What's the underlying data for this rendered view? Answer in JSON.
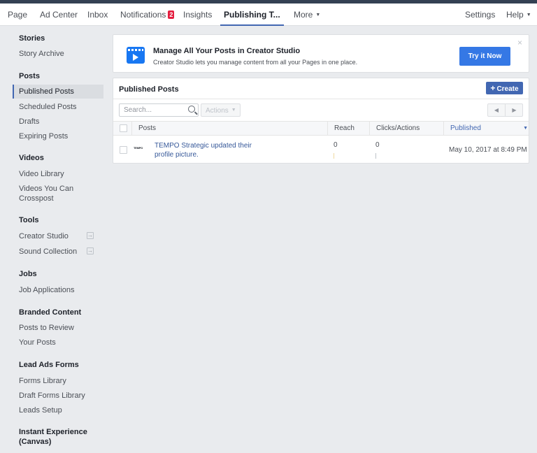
{
  "nav": {
    "items": [
      {
        "label": "Page"
      },
      {
        "label": "Ad Center"
      },
      {
        "label": "Inbox"
      },
      {
        "label": "Notifications",
        "badge": "2"
      },
      {
        "label": "Insights"
      },
      {
        "label": "Publishing T..."
      },
      {
        "label": "More"
      }
    ],
    "active": "Publishing T...",
    "settings_label": "Settings",
    "help_label": "Help"
  },
  "sidebar": {
    "sections": [
      {
        "heading": "Stories",
        "items": [
          "Story Archive"
        ]
      },
      {
        "heading": "Posts",
        "items": [
          "Published Posts",
          "Scheduled Posts",
          "Drafts",
          "Expiring Posts"
        ]
      },
      {
        "heading": "Videos",
        "items": [
          "Video Library",
          "Videos You Can Crosspost"
        ]
      },
      {
        "heading": "Tools",
        "items": [
          "Creator Studio",
          "Sound Collection"
        ]
      },
      {
        "heading": "Jobs",
        "items": [
          "Job Applications"
        ]
      },
      {
        "heading": "Branded Content",
        "items": [
          "Posts to Review",
          "Your Posts"
        ]
      },
      {
        "heading": "Lead Ads Forms",
        "items": [
          "Forms Library",
          "Draft Forms Library",
          "Leads Setup"
        ]
      },
      {
        "heading": "Instant Experience (Canvas)",
        "items": []
      }
    ],
    "active_item": "Published Posts"
  },
  "banner": {
    "icon": "creator-studio-clapper-icon",
    "title": "Manage All Your Posts in Creator Studio",
    "subtitle": "Creator Studio lets you manage content from all your Pages in one place.",
    "button_label": "Try it Now",
    "close_glyph": "×"
  },
  "panel": {
    "title": "Published Posts",
    "create_label": "Create",
    "search_placeholder": "Search...",
    "actions_label": "Actions",
    "columns": [
      "Posts",
      "Reach",
      "Clicks/Actions",
      "Published"
    ],
    "sorted_column": "Published",
    "rows": [
      {
        "thumb_text": "TEMPO",
        "post": "TEMPO Strategic updated their profile picture.",
        "reach": "0",
        "clicks": "0",
        "published": "May 10, 2017 at 8:49 PM"
      }
    ]
  },
  "colors": {
    "accent": "#4267b2",
    "banner_button": "#3578e5",
    "badge": "#e41e3f",
    "link": "#365899",
    "topbar": "#344153"
  }
}
